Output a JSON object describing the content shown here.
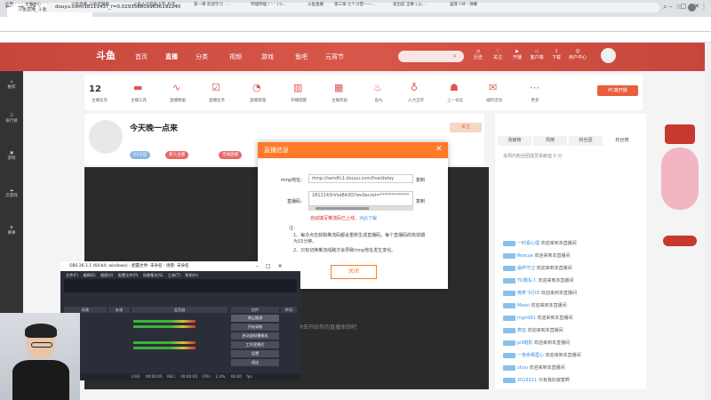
{
  "browser": {
    "tab_title": "斗鱼直播_斗鱼无限精彩直播...",
    "url": "douyu.com/1811143?_r=0.0293568099636192240",
    "bookmarks": [
      "应用",
      "主播中心",
      "斗鱼直播_斗鱼无限精...",
      "斗鱼人气列表小节_抖音...",
      "第一章 欢迎学习 · ...",
      "哔哩哔哩 ( '- ' )つ...",
      "斗鱼直播",
      "第三章 七个习惯——...",
      "退出前 当事 | 公...",
      "猫耳 F.M - 弹幕"
    ]
  },
  "site": {
    "logo": "斗鱼",
    "nav": [
      "首页",
      "直播",
      "分类",
      "视频",
      "游戏",
      "鱼吧",
      "元宵节"
    ],
    "header_icons": [
      "历史",
      "关注",
      "开播",
      "客户端",
      "下载",
      "用户中心"
    ],
    "sidebar": [
      "推荐",
      "排行榜",
      "游戏",
      "云游戏",
      "赛事"
    ],
    "task": {
      "count": "12",
      "items": [
        "主播任务",
        "主播工具",
        "直播数据",
        "直播任务",
        "直播管理",
        "开播提醒",
        "主播奖励",
        "鱼丸",
        "火力全开",
        "实物奖励",
        "上一号位",
        "福利活动",
        "更多"
      ],
      "pc_button": "PC端开播"
    },
    "room": {
      "title": "今天晚一点来",
      "tags": [
        "V1认证",
        "新人主播",
        "无线直播"
      ],
      "like_btn": "关注"
    },
    "video_text": "快去开始你的直播体验吧"
  },
  "right_panel": {
    "tabs": [
      "贡献榜",
      "周榜",
      "粉丝团",
      "粉丝榜"
    ],
    "notice": "本周内粉丝团成员贡献值 0 分",
    "chats": [
      {
        "name": "一时看心理",
        "msg": "欢迎来到本直播间"
      },
      {
        "name": "Rescue",
        "msg": "欢迎来到本直播间"
      },
      {
        "name": "最终守卫",
        "msg": "欢迎来到本直播间"
      },
      {
        "name": "TD赛车人",
        "msg": "欢迎来到本直播间"
      },
      {
        "name": "微笑飞行ID",
        "msg": "欢迎来到本直播间"
      },
      {
        "name": "Mossi",
        "msg": "欢迎来到本直播间"
      },
      {
        "name": "Ingrid91",
        "msg": "欢迎来到本直播间"
      },
      {
        "name": "疯狂",
        "msg": "欢迎来到本直播间"
      },
      {
        "name": "pill暗影",
        "msg": "欢迎来到本直播间"
      },
      {
        "name": "一条命相里心",
        "msg": "欢迎来到本直播间"
      },
      {
        "name": "zhou",
        "msg": "欢迎来到本直播间"
      },
      {
        "name": "2019111",
        "msg": "只有我好寂寞啊"
      }
    ]
  },
  "modal": {
    "title": "直播信息",
    "rtmp_label": "rtmp地址：",
    "rtmp_value": "rtmp://sendfc1.douyu.com/live/delay",
    "code_label": "直播码：",
    "code_value": "1811143rVsd8A3Q?wsSecret=*************",
    "copy": "复制",
    "warning": "自动填写推流码已上线，",
    "warning_link": "点此了解",
    "note_title": "注：",
    "note1": "1、每次点击获取推流码都会重新生成直播码，每个直播码的有效期为15分钟。",
    "note2": "2、只有切换推流线路才会导致rtmp地址发生变化。",
    "button": "关闭"
  },
  "obs": {
    "title": "OBS 26.1.1 (64-bit, windows) - 配置文件: 未命名 - 场景: 未命名",
    "menu": "文件(F) 编辑(E) 视图(V) 配置文件(P) 场景集合(S) 工具(T) 帮助(H)",
    "panels": [
      "场景",
      "来源",
      "混音器",
      "转场",
      "控件"
    ],
    "controls": [
      "停止推流",
      "开始录制",
      "启动虚拟摄像机",
      "工作室模式",
      "设置",
      "退出"
    ],
    "status": "LIVE: 00:00:00  REC: 00:00:00  CPU: 2.4%, 60.00 fps"
  }
}
